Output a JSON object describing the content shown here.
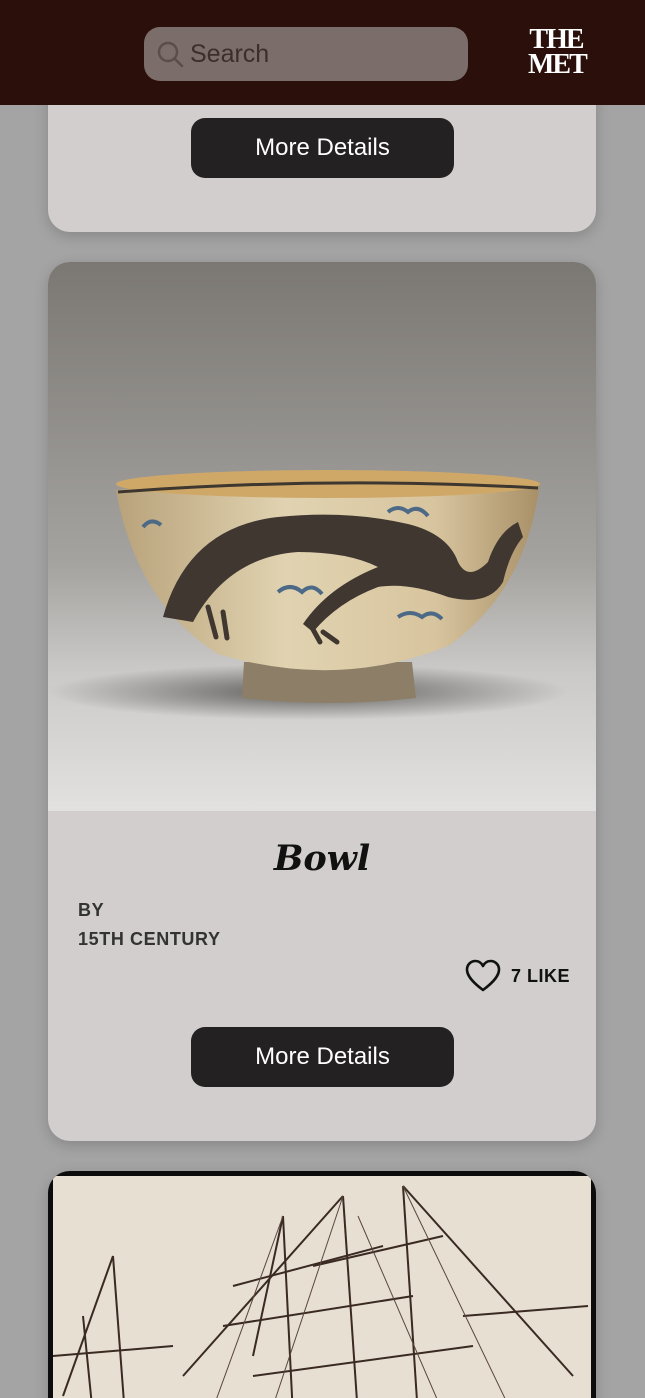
{
  "header": {
    "search_placeholder": "Search",
    "logo_line1": "THE",
    "logo_line2": "MET"
  },
  "cards": {
    "previous": {
      "button_label": "More Details"
    },
    "current": {
      "title": "Bowl",
      "by_label": "BY",
      "date": "15TH CENTURY",
      "likes_label": "7 LIKE",
      "button_label": "More Details"
    }
  },
  "colors": {
    "header_bg": "#2b0f0b",
    "page_bg": "#a4a4a4",
    "card_bg": "#d1cecd",
    "button_bg": "#232121"
  },
  "icons": {
    "search": "search-icon",
    "like": "heart-icon"
  }
}
